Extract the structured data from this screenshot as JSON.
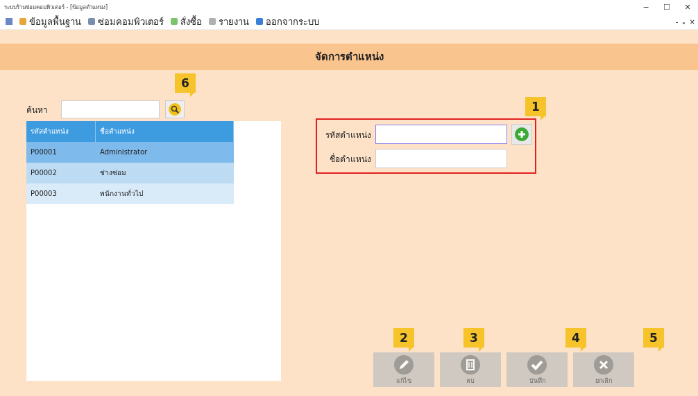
{
  "window": {
    "title": "ระบบร้านซ่อมคอมพิวเตอร์ - [ข้อมูลตำแหน่ง]",
    "controls": [
      "−",
      "☐",
      "✕"
    ],
    "mdi_controls": [
      "-",
      "ₑ",
      "×"
    ]
  },
  "menu": [
    {
      "label": "ข้อมูลพื้นฐาน"
    },
    {
      "label": "ซ่อมคอมพิวเตอร์"
    },
    {
      "label": "สั่งซื้อ"
    },
    {
      "label": "รายงาน"
    },
    {
      "label": "ออกจากระบบ"
    }
  ],
  "header": {
    "title": "จัดการตำแหน่ง"
  },
  "search": {
    "label": "ค้นหา"
  },
  "table": {
    "columns": [
      "รหัสตำแหน่ง",
      "ชื่อตำแหน่ง"
    ],
    "rows": [
      {
        "cells": [
          "P00001",
          "Administrator"
        ],
        "selected": true
      },
      {
        "cells": [
          "P00002",
          "ช่างซ่อม"
        ],
        "selected": false
      },
      {
        "cells": [
          "P00003",
          "พนักงานทั่วไป"
        ],
        "selected": false
      }
    ]
  },
  "form": {
    "fields": [
      {
        "label": "รหัสตำแหน่ง",
        "focused": true
      },
      {
        "label": "ชื่อตำแหน่ง",
        "focused": false
      }
    ]
  },
  "actions": [
    {
      "kind": "edit",
      "label": "แก้ไข",
      "disabled": true
    },
    {
      "kind": "delete",
      "label": "ลบ",
      "disabled": true
    },
    {
      "kind": "save",
      "label": "บันทึก",
      "disabled": true
    },
    {
      "kind": "cancel",
      "label": "ยกเลิก",
      "disabled": true
    }
  ],
  "callouts": [
    "1",
    "2",
    "3",
    "4",
    "5",
    "6"
  ]
}
